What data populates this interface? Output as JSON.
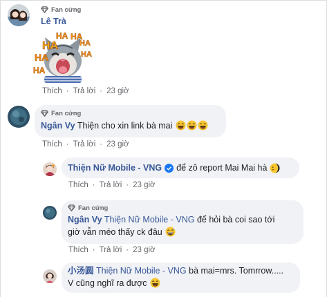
{
  "colors": {
    "link": "#385898",
    "bubble": "#f0f2f5",
    "meta": "#65676b"
  },
  "comments": [
    {
      "badge": "Fan cứng",
      "author": "Lê Trà",
      "sticker_text": "HA",
      "actions": {
        "like": "Thích",
        "reply": "Trả lời",
        "time": "23 giờ"
      }
    },
    {
      "badge": "Fan cứng",
      "author": "Ngân Vy",
      "text": "Thiện cho xin link bà mai",
      "emojis": [
        "laugh-tears-icon",
        "laugh-tears-icon",
        "laugh-tears-icon"
      ],
      "actions": {
        "like": "Thích",
        "reply": "Trả lời",
        "time": "23 giờ"
      }
    }
  ],
  "replies": [
    {
      "author": "Thiện Nữ Mobile - VNG",
      "verified": true,
      "text": "để zô report Mai Mai hà",
      "emoji": "moon-face-icon",
      "actions": {
        "like": "Thích",
        "reply": "Trả lời",
        "time": "23 giờ"
      }
    },
    {
      "badge": "Fan cứng",
      "author": "Ngân Vy",
      "mention": "Thiện Nữ Mobile - VNG",
      "text_line1": "để hỏi bà coi sao tới",
      "text_line2": "giờ vẫn méo thấy ck đâu",
      "emoji": "grin-sweat-icon",
      "actions": {
        "like": "Thích",
        "reply": "Trả lời",
        "time": "23 giờ"
      }
    },
    {
      "author": "小汤圆",
      "mention": "Thiện Nữ Mobile - VNG",
      "text_line1": "bà mai=mrs. Tomrrow.....",
      "text_line2": "V cũng nghĩ ra được",
      "emoji": "laugh-tears-icon"
    }
  ]
}
